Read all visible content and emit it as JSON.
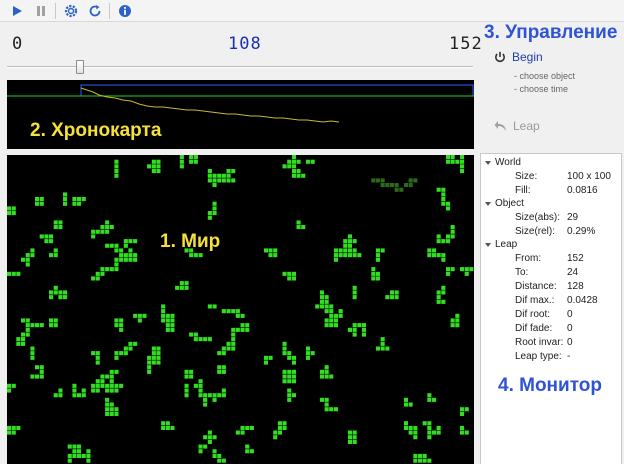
{
  "toolbar": {
    "buttons": [
      {
        "name": "play-button",
        "icon": "play-icon"
      },
      {
        "name": "pause-button",
        "icon": "pause-icon"
      },
      {
        "name": "settings-button",
        "icon": "gear-icon"
      },
      {
        "name": "refresh-button",
        "icon": "refresh-icon"
      },
      {
        "name": "info-button",
        "icon": "info-icon"
      }
    ]
  },
  "timeline": {
    "start": "0",
    "current": "108",
    "end": "152"
  },
  "labels": {
    "chronomap": "2. Хронокарта",
    "world": "1. Мир",
    "control": "3. Управление",
    "monitor": "4. Монитор"
  },
  "control": {
    "begin_label": "Begin",
    "hints": [
      "- choose object",
      "- choose time"
    ],
    "leap_label": "Leap"
  },
  "monitor": {
    "world": {
      "title": "World",
      "rows": [
        {
          "key": "Size:",
          "value": "100 x 100"
        },
        {
          "key": "Fill:",
          "value": "0.0816"
        }
      ]
    },
    "object": {
      "title": "Object",
      "rows": [
        {
          "key": "Size(abs):",
          "value": "29"
        },
        {
          "key": "Size(rel):",
          "value": "0.29%"
        }
      ]
    },
    "leap": {
      "title": "Leap",
      "rows": [
        {
          "key": "From:",
          "value": "152"
        },
        {
          "key": "To:",
          "value": "24"
        },
        {
          "key": "Distance:",
          "value": "128"
        },
        {
          "key": "Dif max.:",
          "value": "0.0428"
        },
        {
          "key": "Dif root:",
          "value": "0"
        },
        {
          "key": "Dif fade:",
          "value": "0"
        },
        {
          "key": "Root invar:",
          "value": "0"
        },
        {
          "key": "Leap type:",
          "value": "-"
        }
      ]
    }
  },
  "colors": {
    "cell": "#33dd22",
    "highlight_cell": "#2a6a1a",
    "trace": "#c8b832",
    "frame_blue": "#2f5bff",
    "frame_green": "#1fcf1f"
  }
}
